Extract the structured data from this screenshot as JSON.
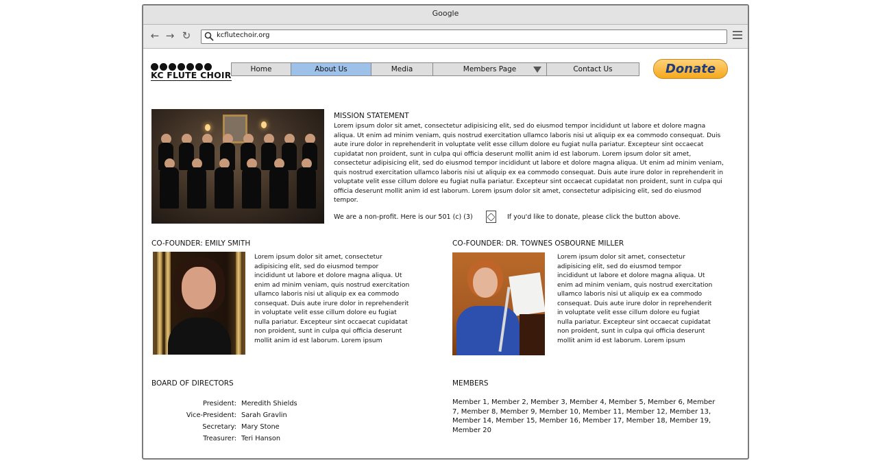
{
  "browser": {
    "title": "Google",
    "url": "kcflutechoir.org"
  },
  "site": {
    "logo_text": "KC FLUTE CHOIR",
    "nav": [
      {
        "label": "Home"
      },
      {
        "label": "About Us",
        "active": true
      },
      {
        "label": "Media"
      },
      {
        "label": "Members Page",
        "dropdown": true
      },
      {
        "label": "Contact Us"
      }
    ],
    "donate_label": "Donate"
  },
  "mission": {
    "title": "MISSION STATEMENT",
    "body": "Lorem ipsum dolor sit amet, consectetur adipisicing elit, sed do eiusmod tempor incididunt ut labore et dolore magna aliqua. Ut enim ad minim veniam, quis nostrud exercitation ullamco laboris nisi ut aliquip ex ea commodo consequat. Duis aute irure dolor in reprehenderit in voluptate velit esse cillum dolore eu fugiat nulla pariatur. Excepteur sint occaecat cupidatat non proident, sunt in culpa qui officia deserunt mollit anim id est laborum. Lorem ipsum dolor sit amet, consectetur adipisicing elit, sed do eiusmod tempor incididunt ut labore et dolore magna aliqua. Ut enim ad minim veniam, quis nostrud exercitation ullamco laboris nisi ut aliquip ex ea commodo consequat. Duis aute irure dolor in reprehenderit in voluptate velit esse cillum dolore eu fugiat nulla pariatur. Excepteur sint occaecat cupidatat non proident, sunt in culpa qui officia deserunt mollit anim id est laborum. Lorem ipsum dolor sit amet, consectetur adipisicing elit, sed do eiusmod tempor.",
    "nonprofit_text": "We are a non-profit. Here is our 501 (c) (3)",
    "donate_note": "If you'd like to donate, please click the button above."
  },
  "cofounders": [
    {
      "title": "CO-FOUNDER: EMILY SMITH",
      "body": "Lorem ipsum dolor sit amet, consectetur adipisicing elit, sed do eiusmod tempor incididunt ut labore et dolore magna aliqua. Ut enim ad minim veniam, quis nostrud exercitation ullamco laboris nisi ut aliquip ex ea commodo consequat. Duis aute irure dolor in reprehenderit in voluptate velit esse cillum dolore eu fugiat nulla pariatur. Excepteur sint occaecat cupidatat non proident, sunt in culpa qui officia deserunt mollit anim id est laborum. Lorem ipsum"
    },
    {
      "title": "CO-FOUNDER: DR. TOWNES OSBOURNE MILLER",
      "body": "Lorem ipsum dolor sit amet, consectetur adipisicing elit, sed do eiusmod tempor incididunt ut labore et dolore magna aliqua. Ut enim ad minim veniam, quis nostrud exercitation ullamco laboris nisi ut aliquip ex ea commodo consequat. Duis aute irure dolor in reprehenderit in voluptate velit esse cillum dolore eu fugiat nulla pariatur. Excepteur sint occaecat cupidatat non proident, sunt in culpa qui officia deserunt mollit anim id est laborum. Lorem ipsum"
    }
  ],
  "board": {
    "title": "BOARD OF DIRECTORS",
    "rows": [
      {
        "role": "President:",
        "name": "Meredith Shields"
      },
      {
        "role": "Vice-President:",
        "name": "Sarah Gravlin"
      },
      {
        "role": "Secretary:",
        "name": "Mary Stone"
      },
      {
        "role": "Treasurer:",
        "name": "Teri Hanson"
      }
    ]
  },
  "members": {
    "title": "MEMBERS",
    "list": "Member 1, Member 2, Member 3, Member 4, Member 5, Member 6, Member 7, Member 8, Member 9, Member 10, Member 11, Member 12, Member 13, Member 14, Member 15, Member 16, Member 17, Member 18, Member 19, Member 20"
  },
  "colors": {
    "nav_active": "#9ec1ea",
    "donate_button": "#f5a81c",
    "donate_text": "#1f3c7a"
  }
}
